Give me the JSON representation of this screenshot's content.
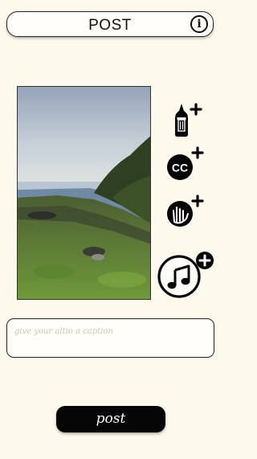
{
  "header": {
    "title": "POST",
    "info_icon": "i"
  },
  "side_actions": [
    {
      "name": "add-filter",
      "icon": "paint-tube-plus-icon"
    },
    {
      "name": "add-captions",
      "icon": "closed-captions-plus-icon",
      "label": "CC"
    },
    {
      "name": "add-gesture",
      "icon": "hand-plus-icon"
    },
    {
      "name": "add-music",
      "icon": "music-note-plus-icon"
    }
  ],
  "caption": {
    "placeholder": "give your altio a caption"
  },
  "post_button": {
    "label": "post"
  }
}
